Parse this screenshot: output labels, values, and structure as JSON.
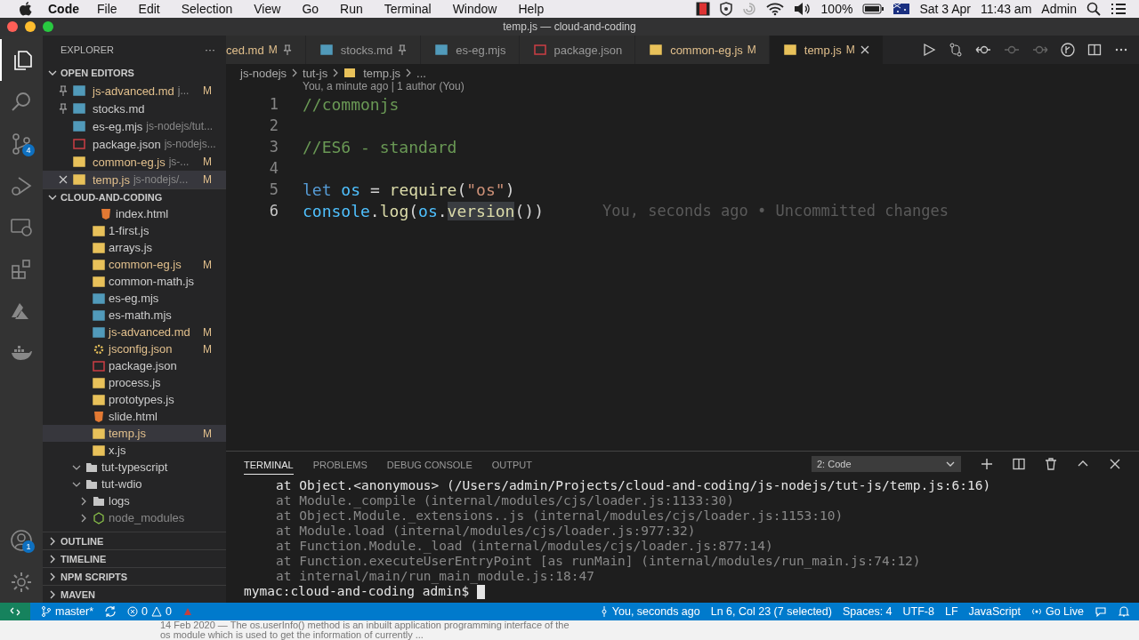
{
  "menu_bar": {
    "app": "Code",
    "items": [
      "File",
      "Edit",
      "Selection",
      "View",
      "Go",
      "Run",
      "Terminal",
      "Window",
      "Help"
    ],
    "battery": "100%",
    "date": "Sat 3 Apr",
    "time": "11:43 am",
    "user": "Admin"
  },
  "window": {
    "title": "temp.js — cloud-and-coding"
  },
  "activity_bar": [
    {
      "kind": "files",
      "selected": true
    },
    {
      "kind": "search",
      "selected": false
    },
    {
      "kind": "source-control",
      "selected": false,
      "badge": "4"
    },
    {
      "kind": "debug",
      "selected": false
    },
    {
      "kind": "remote",
      "selected": false
    },
    {
      "kind": "extensions",
      "selected": false
    },
    {
      "kind": "azure",
      "selected": false
    },
    {
      "kind": "docker",
      "selected": false
    }
  ],
  "activity_bottom": [
    {
      "kind": "accounts",
      "badge": "1"
    },
    {
      "kind": "settings"
    }
  ],
  "sidebar": {
    "title": "EXPLORER",
    "more": "···",
    "open_editors": {
      "title": "OPEN EDITORS",
      "items": [
        {
          "name": "js-advanced.md",
          "path": "j...",
          "kind": "md",
          "modified": true,
          "status": "M",
          "pinned": true,
          "selected": false
        },
        {
          "name": "stocks.md",
          "kind": "md",
          "modified": false,
          "pinned": true,
          "selected": false
        },
        {
          "name": "es-eg.mjs",
          "path": "js-nodejs/tut...",
          "kind": "mjs",
          "modified": false,
          "pinned": false,
          "selected": false
        },
        {
          "name": "package.json",
          "path": "js-nodejs...",
          "kind": "json",
          "modified": false,
          "pinned": false,
          "selected": false
        },
        {
          "name": "common-eg.js",
          "path": "js-...",
          "kind": "js",
          "modified": true,
          "status": "M",
          "pinned": false,
          "selected": false
        },
        {
          "name": "temp.js",
          "path": "js-nodejs/...",
          "kind": "js",
          "modified": true,
          "status": "M",
          "pinned": false,
          "selected": true
        }
      ]
    },
    "project": {
      "title": "CLOUD-AND-CODING",
      "tree": [
        {
          "children": [
            {
              "children": [
                {
                  "name": "index.html",
                  "kind": "html",
                  "modified": false,
                  "selected": false
                }
              ]
            },
            {
              "name": "1-first.js",
              "kind": "js",
              "modified": false,
              "selected": false
            },
            {
              "name": "arrays.js",
              "kind": "js",
              "modified": false,
              "selected": false
            },
            {
              "name": "common-eg.js",
              "kind": "js",
              "modified": true,
              "status": "M",
              "selected": false
            },
            {
              "name": "common-math.js",
              "kind": "js",
              "modified": false,
              "selected": false
            },
            {
              "name": "es-eg.mjs",
              "kind": "mjs",
              "modified": false,
              "selected": false
            },
            {
              "name": "es-math.mjs",
              "kind": "mjs",
              "modified": false,
              "selected": false
            },
            {
              "name": "js-advanced.md",
              "kind": "md",
              "modified": true,
              "status": "M",
              "selected": false
            },
            {
              "name": "jsconfig.json",
              "kind": "config",
              "modified": true,
              "status": "M",
              "selected": false
            },
            {
              "name": "package.json",
              "kind": "json",
              "modified": false,
              "selected": false
            },
            {
              "name": "process.js",
              "kind": "js",
              "modified": false,
              "selected": false
            },
            {
              "name": "prototypes.js",
              "kind": "js",
              "modified": false,
              "selected": false
            },
            {
              "name": "slide.html",
              "kind": "html",
              "modified": false,
              "selected": false
            },
            {
              "name": "temp.js",
              "kind": "js",
              "modified": true,
              "status": "M",
              "selected": true
            },
            {
              "name": "x.js",
              "kind": "js",
              "modified": false,
              "selected": false
            }
          ]
        },
        {
          "name": "tut-typescript",
          "kind": "folder",
          "expanded": true,
          "selected": false
        },
        {
          "name": "tut-wdio",
          "kind": "folder",
          "expanded": true,
          "selected": false,
          "children": [
            {
              "name": "logs",
              "kind": "folder",
              "expanded": false,
              "selected": false
            },
            {
              "name": "node_modules",
              "kind": "node",
              "expanded": false,
              "selected": false,
              "dim": true
            }
          ]
        }
      ]
    },
    "sections": [
      "OUTLINE",
      "TIMELINE",
      "NPM SCRIPTS",
      "MAVEN"
    ]
  },
  "tabs": [
    {
      "label": "ced.md",
      "modified": true,
      "status": "M",
      "pinned": true,
      "selected": false
    },
    {
      "label": "stocks.md",
      "kind": "md",
      "modified": false,
      "pinned": true,
      "selected": false
    },
    {
      "label": "es-eg.mjs",
      "kind": "mjs",
      "modified": false,
      "pinned": false,
      "selected": false
    },
    {
      "label": "package.json",
      "kind": "json",
      "modified": false,
      "pinned": false,
      "selected": false
    },
    {
      "label": "common-eg.js",
      "kind": "js",
      "modified": true,
      "status": "M",
      "pinned": false,
      "selected": false
    },
    {
      "label": "temp.js",
      "kind": "js",
      "modified": true,
      "status": "M",
      "pinned": false,
      "selected": true
    }
  ],
  "breadcrumb": [
    {
      "label": "js-nodejs"
    },
    {
      "label": "tut-js"
    },
    {
      "label": "temp.js",
      "kind": "js"
    },
    {
      "label": "..."
    }
  ],
  "editor": {
    "codelens": "You, a minute ago | 1 author (You)",
    "lines": [
      {
        "number": "1",
        "current": false,
        "tokens": [
          {
            "text": "//commonjs",
            "kind": "comment"
          }
        ]
      },
      {
        "number": "2",
        "current": false
      },
      {
        "number": "3",
        "current": false,
        "tokens": [
          {
            "text": "//ES6 - standard",
            "kind": "comment"
          }
        ]
      },
      {
        "number": "4",
        "current": false
      },
      {
        "number": "5",
        "current": false,
        "tokens": [
          {
            "text": "let ",
            "kind": "keyword"
          },
          {
            "text": "os",
            "kind": "var"
          },
          {
            "text": " = ",
            "kind": "plain"
          },
          {
            "text": "require",
            "kind": "func"
          },
          {
            "text": "(",
            "kind": "plain"
          },
          {
            "text": "\"os\"",
            "kind": "string"
          },
          {
            "text": ")",
            "kind": "plain"
          }
        ]
      },
      {
        "number": "6",
        "current": true,
        "blame": "You, seconds ago • Uncommitted changes",
        "tokens": [
          {
            "text": "console",
            "kind": "var"
          },
          {
            "text": ".",
            "kind": "plain"
          },
          {
            "text": "log",
            "kind": "func"
          },
          {
            "text": "(",
            "kind": "plain"
          },
          {
            "text": "os",
            "kind": "var"
          },
          {
            "text": ".",
            "kind": "plain"
          },
          {
            "text": "version",
            "kind": "selection"
          },
          {
            "text": "())",
            "kind": "plain"
          }
        ]
      }
    ]
  },
  "panel": {
    "tabs": [
      {
        "label": "TERMINAL",
        "selected": true
      },
      {
        "label": "PROBLEMS",
        "selected": false
      },
      {
        "label": "DEBUG CONSOLE",
        "selected": false
      },
      {
        "label": "OUTPUT",
        "selected": false
      }
    ],
    "terminal_select": "2: Code",
    "lines": [
      {
        "text": "at Object.<anonymous> (/Users/admin/Projects/cloud-and-coding/js-nodejs/tut-js/temp.js:6:16)",
        "kind": "bright"
      },
      {
        "text": "at Module._compile (internal/modules/cjs/loader.js:1133:30)",
        "kind": "dim"
      },
      {
        "text": "at Object.Module._extensions..js (internal/modules/cjs/loader.js:1153:10)",
        "kind": "dim"
      },
      {
        "text": "at Module.load (internal/modules/cjs/loader.js:977:32)",
        "kind": "dim"
      },
      {
        "text": "at Function.Module._load (internal/modules/cjs/loader.js:877:14)",
        "kind": "dim"
      },
      {
        "text": "at Function.executeUserEntryPoint [as runMain] (internal/modules/run_main.js:74:12)",
        "kind": "dim"
      },
      {
        "text": "at internal/main/run_main_module.js:18:47",
        "kind": "dim"
      }
    ],
    "prompt": "mymac:cloud-and-coding admin$"
  },
  "status_bar": {
    "branch": "master*",
    "errors": "0",
    "warnings": "0",
    "right": [
      {
        "label": "You, seconds ago",
        "kind": "git"
      },
      {
        "label": "Ln 6, Col 23 (7 selected)"
      },
      {
        "label": "Spaces: 4"
      },
      {
        "label": "UTF-8"
      },
      {
        "label": "LF"
      },
      {
        "label": "JavaScript"
      },
      {
        "label": "Go Live",
        "kind": "live"
      }
    ]
  },
  "background_page": [
    "14 Feb 2020 — The os.userInfo() method is an inbuilt application programming interface of the",
    "os module which is used to get the information of currently ..."
  ]
}
